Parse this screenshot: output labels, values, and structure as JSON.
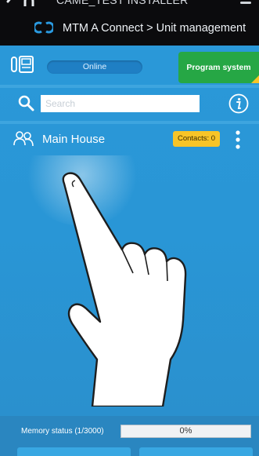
{
  "header": {
    "app_title": "CAME_TEST INSTALLER",
    "breadcrumb": "MTM A Connect > Unit management"
  },
  "status": {
    "connection": "Online",
    "program_button": "Program system"
  },
  "search": {
    "placeholder": "Search",
    "value": ""
  },
  "units": [
    {
      "name": "Main House",
      "contacts_label": "Contacts: 0"
    }
  ],
  "memory": {
    "label": "Memory status (1/3000)",
    "value": "0%",
    "fraction": 0
  },
  "colors": {
    "panel": "#2996d6",
    "program_button": "#26a745",
    "badge": "#f7c428",
    "header": "#0b0b0d"
  },
  "icons": [
    "back-icon",
    "menu-icon",
    "connect-logo-icon",
    "intercom-icon",
    "search-icon",
    "info-icon",
    "user-group-icon",
    "more-vertical-icon",
    "pointing-hand-icon"
  ]
}
